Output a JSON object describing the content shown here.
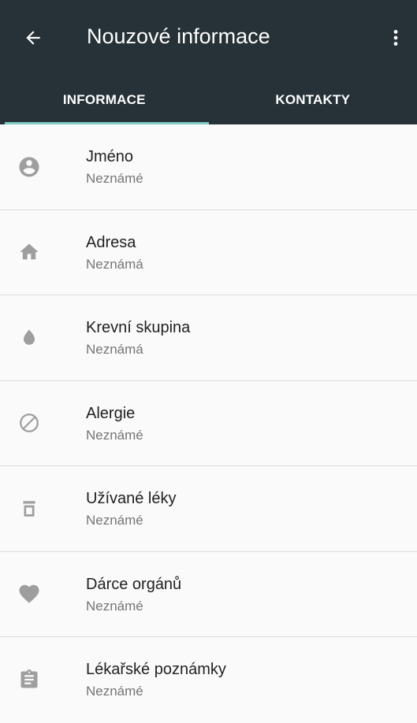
{
  "header": {
    "title": "Nouzové informace",
    "back_icon": "arrow-back-icon",
    "menu_icon": "more-vert-icon",
    "background": "#263238",
    "indicator_color": "#80cbc4"
  },
  "tabs": [
    {
      "label": "INFORMACE",
      "selected": true
    },
    {
      "label": "KONTAKTY",
      "selected": false
    }
  ],
  "items": [
    {
      "title": "Jméno",
      "value": "Neznámé",
      "icon": "account-circle-icon"
    },
    {
      "title": "Adresa",
      "value": "Neznámá",
      "icon": "home-icon"
    },
    {
      "title": "Krevní skupina",
      "value": "Neznámá",
      "icon": "blood-drop-icon"
    },
    {
      "title": "Alergie",
      "value": "Neznámé",
      "icon": "block-icon"
    },
    {
      "title": "Užívané léky",
      "value": "Neznámé",
      "icon": "pill-bottle-icon"
    },
    {
      "title": "Dárce orgánů",
      "value": "Neznámé",
      "icon": "heart-icon"
    },
    {
      "title": "Lékařské poznámky",
      "value": "Neznámé",
      "icon": "clipboard-icon"
    }
  ]
}
